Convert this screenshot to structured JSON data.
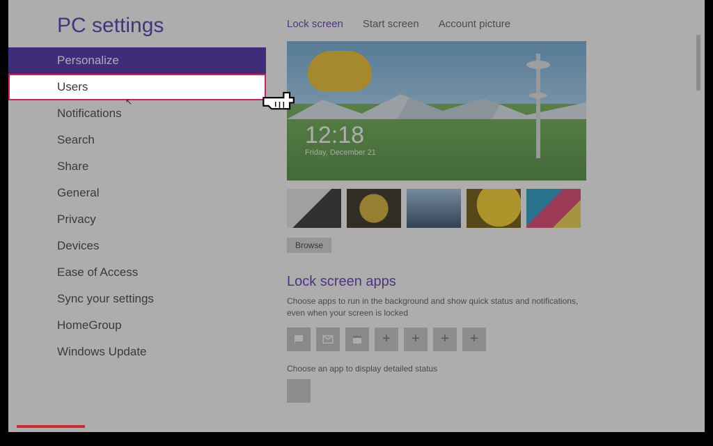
{
  "title": "PC settings",
  "sidebar": {
    "items": [
      {
        "label": "Personalize",
        "selected": true
      },
      {
        "label": "Users",
        "hover": true
      },
      {
        "label": "Notifications"
      },
      {
        "label": "Search"
      },
      {
        "label": "Share"
      },
      {
        "label": "General"
      },
      {
        "label": "Privacy"
      },
      {
        "label": "Devices"
      },
      {
        "label": "Ease of Access"
      },
      {
        "label": "Sync your settings"
      },
      {
        "label": "HomeGroup"
      },
      {
        "label": "Windows Update"
      }
    ]
  },
  "tabs": [
    {
      "label": "Lock screen",
      "active": true
    },
    {
      "label": "Start screen"
    },
    {
      "label": "Account picture"
    }
  ],
  "preview": {
    "time": "12:18",
    "date": "Friday, December 21"
  },
  "browse_label": "Browse",
  "lock_apps": {
    "heading": "Lock screen apps",
    "desc": "Choose apps to run in the background and show quick status and notifications, even when your screen is locked",
    "detail_desc": "Choose an app to display detailed status"
  }
}
